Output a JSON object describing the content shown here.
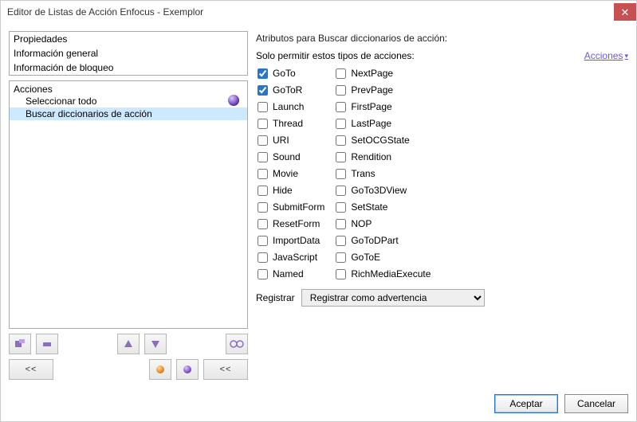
{
  "window": {
    "title": "Editor de Listas de Acción Enfocus - Exemplor"
  },
  "left": {
    "props": [
      "Propiedades",
      "Información general",
      "Información de bloqueo"
    ],
    "actions_header": "Acciones",
    "actions": [
      {
        "label": "Seleccionar todo",
        "selected": false
      },
      {
        "label": "Buscar diccionarios de acción",
        "selected": true
      }
    ],
    "toolbar_bottom": {
      "row1": {
        "btn_add": "add-block-icon",
        "btn_remove": "remove-block-icon",
        "btn_up": "arrow-up-icon",
        "btn_down": "arrow-down-icon",
        "btn_glasses": "glasses-icon"
      },
      "row2": {
        "btn_prev": "<<",
        "orange_dot": "record-icon",
        "purple_dot": "marker-icon",
        "btn_next": "<<"
      }
    }
  },
  "right": {
    "panel_title": "Atributos para Buscar diccionarios de acción:",
    "subhead": "Solo permitir estos tipos de acciones:",
    "actions_link": "Acciones",
    "col1": [
      {
        "label": "GoTo",
        "checked": true
      },
      {
        "label": "GoToR",
        "checked": true
      },
      {
        "label": "Launch",
        "checked": false
      },
      {
        "label": "Thread",
        "checked": false
      },
      {
        "label": "URI",
        "checked": false
      },
      {
        "label": "Sound",
        "checked": false
      },
      {
        "label": "Movie",
        "checked": false
      },
      {
        "label": "Hide",
        "checked": false
      },
      {
        "label": "SubmitForm",
        "checked": false
      },
      {
        "label": "ResetForm",
        "checked": false
      },
      {
        "label": "ImportData",
        "checked": false
      },
      {
        "label": "JavaScript",
        "checked": false
      },
      {
        "label": "Named",
        "checked": false
      }
    ],
    "col2": [
      {
        "label": "NextPage",
        "checked": false
      },
      {
        "label": "PrevPage",
        "checked": false
      },
      {
        "label": "FirstPage",
        "checked": false
      },
      {
        "label": "LastPage",
        "checked": false
      },
      {
        "label": "SetOCGState",
        "checked": false
      },
      {
        "label": "Rendition",
        "checked": false
      },
      {
        "label": "Trans",
        "checked": false
      },
      {
        "label": "GoTo3DView",
        "checked": false
      },
      {
        "label": "SetState",
        "checked": false
      },
      {
        "label": "NOP",
        "checked": false
      },
      {
        "label": "GoToDPart",
        "checked": false
      },
      {
        "label": "GoToE",
        "checked": false
      },
      {
        "label": "RichMediaExecute",
        "checked": false
      }
    ],
    "register_label": "Registrar",
    "register_value": "Registrar como advertencia"
  },
  "footer": {
    "ok": "Aceptar",
    "cancel": "Cancelar"
  }
}
